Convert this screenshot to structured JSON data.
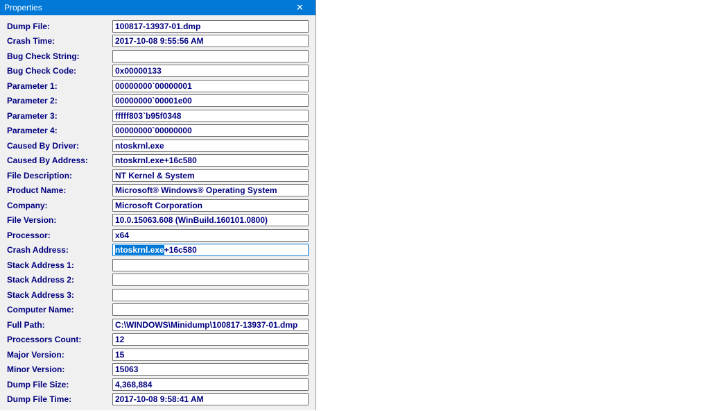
{
  "window": {
    "title": "Properties"
  },
  "fields": {
    "dump_file": {
      "label": "Dump File:",
      "value": "100817-13937-01.dmp"
    },
    "crash_time": {
      "label": "Crash Time:",
      "value": "2017-10-08 9:55:56 AM"
    },
    "bug_check_string": {
      "label": "Bug Check String:",
      "value": ""
    },
    "bug_check_code": {
      "label": "Bug Check Code:",
      "value": "0x00000133"
    },
    "param1": {
      "label": "Parameter 1:",
      "value": "00000000`00000001"
    },
    "param2": {
      "label": "Parameter 2:",
      "value": "00000000`00001e00"
    },
    "param3": {
      "label": "Parameter 3:",
      "value": "fffff803`b95f0348"
    },
    "param4": {
      "label": "Parameter 4:",
      "value": "00000000`00000000"
    },
    "caused_by_driver": {
      "label": "Caused By Driver:",
      "value": "ntoskrnl.exe"
    },
    "caused_by_addr": {
      "label": "Caused By Address:",
      "value": "ntoskrnl.exe+16c580"
    },
    "file_desc": {
      "label": "File Description:",
      "value": "NT Kernel & System"
    },
    "product_name": {
      "label": "Product Name:",
      "value": "Microsoft® Windows® Operating System"
    },
    "company": {
      "label": "Company:",
      "value": "Microsoft Corporation"
    },
    "file_version": {
      "label": "File Version:",
      "value": "10.0.15063.608 (WinBuild.160101.0800)"
    },
    "processor": {
      "label": "Processor:",
      "value": "x64"
    },
    "crash_addr": {
      "label": "Crash Address:",
      "sel": "ntoskrnl.exe",
      "rest": "+16c580"
    },
    "stack1": {
      "label": "Stack Address 1:",
      "value": ""
    },
    "stack2": {
      "label": "Stack Address 2:",
      "value": ""
    },
    "stack3": {
      "label": "Stack Address 3:",
      "value": ""
    },
    "computer_name": {
      "label": "Computer Name:",
      "value": ""
    },
    "full_path": {
      "label": "Full Path:",
      "value": "C:\\WINDOWS\\Minidump\\100817-13937-01.dmp"
    },
    "proc_count": {
      "label": "Processors Count:",
      "value": "12"
    },
    "major_ver": {
      "label": "Major Version:",
      "value": "15"
    },
    "minor_ver": {
      "label": "Minor Version:",
      "value": "15063"
    },
    "dump_size": {
      "label": "Dump File Size:",
      "value": "4,368,884"
    },
    "dump_time": {
      "label": "Dump File Time:",
      "value": "2017-10-08 9:58:41 AM"
    }
  }
}
